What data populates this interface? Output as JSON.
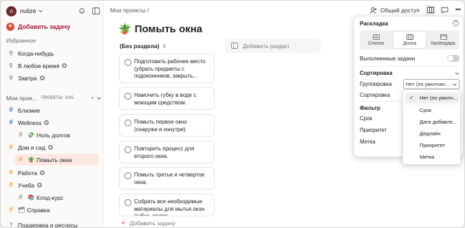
{
  "sidebar": {
    "avatar_letter": "n",
    "user": "nulize",
    "add_task": "Добавить задачу",
    "favorites_header": "Избранное",
    "favorites": [
      {
        "label": "Когда-нибудь"
      },
      {
        "label": "В любое время"
      },
      {
        "label": "Завтра"
      }
    ],
    "projects_header": "Мои прое...",
    "projects_badge": "ПРОЕКТЫ: 10/5",
    "projects": [
      {
        "label": "Близкие",
        "color": "#4073d6"
      },
      {
        "label": "Wellness",
        "color": "#4073d6"
      },
      {
        "label": "Ноль долгов",
        "color": "#999999",
        "emoji": "💸"
      },
      {
        "label": "Дом и сад",
        "color": "#e8a83f",
        "emoji": "🏡"
      },
      {
        "label": "Помыть окна",
        "color": "#e8a83f",
        "emoji": "🪴"
      },
      {
        "label": "Работа",
        "color": "#e8a83f"
      },
      {
        "label": "Учеба",
        "color": "#e8a83f"
      },
      {
        "label": "Клод-курс",
        "color": "#999999",
        "emoji": "📚"
      },
      {
        "label": "Справка",
        "color": "#e8a83f",
        "emoji": "🗂"
      }
    ],
    "bottom": "Поддержка и ресурсы"
  },
  "main": {
    "breadcrumb": "Мои проекты /",
    "share": "Общий доступ",
    "title_emoji": "🪴",
    "title": "Помыть окна",
    "section_label": "(Без раздела)",
    "section_count": "6",
    "add_section": "Добавить раздел",
    "add_task_bottom": "Добавить задачу",
    "cards": [
      {
        "text": "Подготовить рабочее место (убрать предметы с подоконников, закрыть..."
      },
      {
        "text": "Намочить губку в воде с моющим средством."
      },
      {
        "text": "Помыть первое окно (снаружи и изнутри)."
      },
      {
        "text": "Повторить процесс для второго окна."
      },
      {
        "text": "Помыть третье и четвертое окна."
      },
      {
        "text": "Собрать все необходимые материалы для мытья окон (губка, ведро,..."
      }
    ]
  },
  "popover": {
    "title": "Раскладка",
    "views": [
      {
        "label": "Список"
      },
      {
        "label": "Доска"
      },
      {
        "label": "Календарь"
      }
    ],
    "completed_label": "Выполненные задачи",
    "sort_header": "Сортировка",
    "grouping_label": "Группировка",
    "grouping_value": "Нет (по умолчан...",
    "sorting_label": "Сортировка",
    "filter_header": "Фильтр",
    "filter_items": [
      {
        "label": "Срок"
      },
      {
        "label": "Приоритет"
      },
      {
        "label": "Метка"
      }
    ]
  },
  "dropdown": {
    "items": [
      {
        "label": "Нет (по умолч..."
      },
      {
        "label": "Срок"
      },
      {
        "label": "Дата добавле..."
      },
      {
        "label": "Дедлайн"
      },
      {
        "label": "Приоритет"
      },
      {
        "label": "Метка"
      }
    ]
  },
  "colors": {
    "accent": "#dc4c3e",
    "active_bg": "#fde9e4"
  }
}
